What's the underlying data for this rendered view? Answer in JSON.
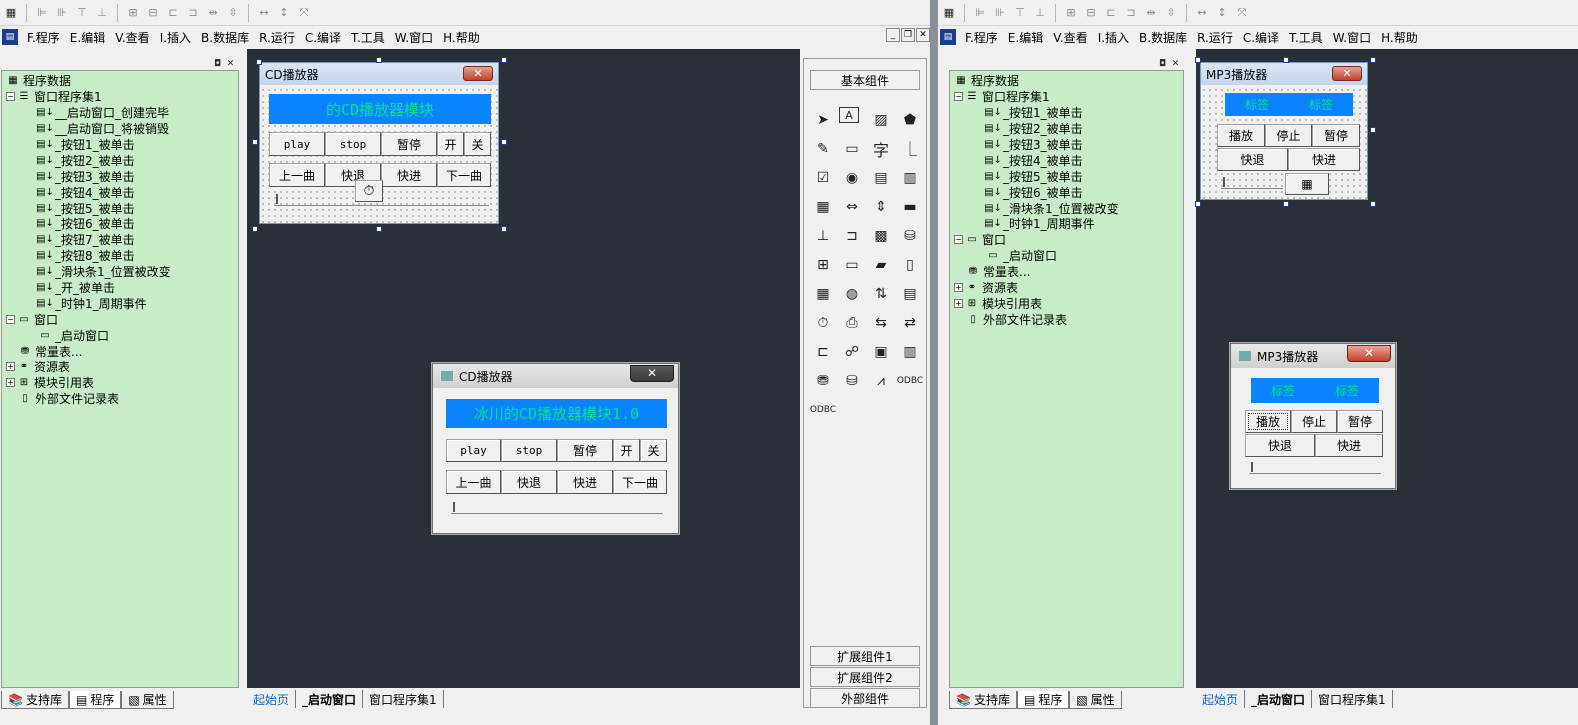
{
  "left_window": {
    "menu": [
      "F.程序",
      "E.编辑",
      "V.查看",
      "I.插入",
      "B.数据库",
      "R.运行",
      "C.编译",
      "T.工具",
      "W.窗口",
      "H.帮助"
    ],
    "tree": [
      {
        "level": 0,
        "icon": "program-data-icon",
        "label": "程序数据",
        "exp": ""
      },
      {
        "level": 0,
        "icon": "module-icon",
        "label": "窗口程序集1",
        "exp": "−"
      },
      {
        "level": 2,
        "icon": "sub-icon",
        "label": "__启动窗口_创建完毕",
        "exp": ""
      },
      {
        "level": 2,
        "icon": "sub-icon",
        "label": "__启动窗口_将被销毁",
        "exp": ""
      },
      {
        "level": 2,
        "icon": "sub-icon",
        "label": "_按钮1_被单击",
        "exp": ""
      },
      {
        "level": 2,
        "icon": "sub-icon",
        "label": "_按钮2_被单击",
        "exp": ""
      },
      {
        "level": 2,
        "icon": "sub-icon",
        "label": "_按钮3_被单击",
        "exp": ""
      },
      {
        "level": 2,
        "icon": "sub-icon",
        "label": "_按钮4_被单击",
        "exp": ""
      },
      {
        "level": 2,
        "icon": "sub-icon",
        "label": "_按钮5_被单击",
        "exp": ""
      },
      {
        "level": 2,
        "icon": "sub-icon",
        "label": "_按钮6_被单击",
        "exp": ""
      },
      {
        "level": 2,
        "icon": "sub-icon",
        "label": "_按钮7_被单击",
        "exp": ""
      },
      {
        "level": 2,
        "icon": "sub-icon",
        "label": "_按钮8_被单击",
        "exp": ""
      },
      {
        "level": 2,
        "icon": "sub-icon",
        "label": "_滑块条1_位置被改变",
        "exp": ""
      },
      {
        "level": 2,
        "icon": "sub-icon",
        "label": "_开_被单击",
        "exp": ""
      },
      {
        "level": 2,
        "icon": "sub-icon",
        "label": "_时钟1_周期事件",
        "exp": ""
      },
      {
        "level": 0,
        "icon": "window-icon",
        "label": "窗口",
        "exp": "−"
      },
      {
        "level": 2,
        "icon": "window-icon",
        "label": "_启动窗口",
        "exp": ""
      },
      {
        "level": 1,
        "icon": "constant-icon",
        "label": "常量表...",
        "exp": ""
      },
      {
        "level": 0,
        "icon": "resource-icon",
        "label": "资源表",
        "exp": "+"
      },
      {
        "level": 0,
        "icon": "module-ref-icon",
        "label": "模块引用表",
        "exp": "+"
      },
      {
        "level": 1,
        "icon": "file-icon",
        "label": "外部文件记录表",
        "exp": ""
      }
    ],
    "bottom_tabs": [
      "支持库",
      "程序",
      "属性"
    ],
    "doc_tabs": [
      "起始页",
      "_启动窗口",
      "窗口程序集1"
    ],
    "design_form": {
      "title": "CD播放器",
      "label": "的CD播放器模块",
      "row1": [
        "play",
        "stop",
        "暂停",
        "开",
        "关"
      ],
      "row2": [
        "上一曲",
        "快退",
        "快进",
        "下一曲"
      ]
    },
    "run_form": {
      "title": "CD播放器",
      "label": "冰川的CD播放器模块1.0",
      "row1": [
        "play",
        "stop",
        "暂停",
        "开",
        "关"
      ],
      "row2": [
        "上一曲",
        "快退",
        "快进",
        "下一曲"
      ],
      "close": "✕"
    },
    "components": {
      "header": "基本组件",
      "footer": [
        "扩展组件1",
        "扩展组件2",
        "外部组件"
      ]
    }
  },
  "right_window": {
    "menu": [
      "F.程序",
      "E.编辑",
      "V.查看",
      "I.插入",
      "B.数据库",
      "R.运行",
      "C.编译",
      "T.工具",
      "W.窗口",
      "H.帮助"
    ],
    "tree": [
      {
        "level": 0,
        "icon": "program-data-icon",
        "label": "程序数据",
        "exp": ""
      },
      {
        "level": 0,
        "icon": "module-icon",
        "label": "窗口程序集1",
        "exp": "−"
      },
      {
        "level": 2,
        "icon": "sub-icon",
        "label": "_按钮1_被单击",
        "exp": ""
      },
      {
        "level": 2,
        "icon": "sub-icon",
        "label": "_按钮2_被单击",
        "exp": ""
      },
      {
        "level": 2,
        "icon": "sub-icon",
        "label": "_按钮3_被单击",
        "exp": ""
      },
      {
        "level": 2,
        "icon": "sub-icon",
        "label": "_按钮4_被单击",
        "exp": ""
      },
      {
        "level": 2,
        "icon": "sub-icon",
        "label": "_按钮5_被单击",
        "exp": ""
      },
      {
        "level": 2,
        "icon": "sub-icon",
        "label": "_按钮6_被单击",
        "exp": ""
      },
      {
        "level": 2,
        "icon": "sub-icon",
        "label": "_滑块条1_位置被改变",
        "exp": ""
      },
      {
        "level": 2,
        "icon": "sub-icon",
        "label": "_时钟1_周期事件",
        "exp": ""
      },
      {
        "level": 0,
        "icon": "window-icon",
        "label": "窗口",
        "exp": "−"
      },
      {
        "level": 2,
        "icon": "window-icon",
        "label": "_启动窗口",
        "exp": ""
      },
      {
        "level": 1,
        "icon": "constant-icon",
        "label": "常量表...",
        "exp": ""
      },
      {
        "level": 0,
        "icon": "resource-icon",
        "label": "资源表",
        "exp": "+"
      },
      {
        "level": 0,
        "icon": "module-ref-icon",
        "label": "模块引用表",
        "exp": "+"
      },
      {
        "level": 1,
        "icon": "file-icon",
        "label": "外部文件记录表",
        "exp": ""
      }
    ],
    "bottom_tabs": [
      "支持库",
      "程序",
      "属性"
    ],
    "doc_tabs": [
      "起始页",
      "_启动窗口",
      "窗口程序集1"
    ],
    "design_form": {
      "title": "MP3播放器",
      "label1": "标签",
      "label2": "标签",
      "row1": [
        "播放",
        "停止",
        "暂停"
      ],
      "row2": [
        "快退",
        "快进"
      ]
    },
    "run_form": {
      "title": "MP3播放器",
      "label1": "标签",
      "label2": "标签",
      "row1": [
        "播放",
        "停止",
        "暂停"
      ],
      "row2": [
        "快退",
        "快进"
      ],
      "close": "✕"
    }
  },
  "colors": {
    "tree_bg": "#c8ecc8",
    "design_bg": "#2b3038",
    "label_bg": "#0a84ff",
    "label_fg": "#00e58a"
  }
}
